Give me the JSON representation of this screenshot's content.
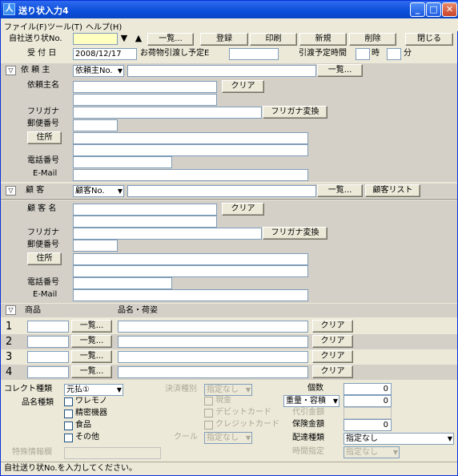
{
  "window": {
    "title": "送り状入力4",
    "minimize": "_",
    "maximize": "□",
    "close": "✕"
  },
  "menu": [
    "ファイル(F)",
    "ツール(T)",
    "ヘルプ(H)"
  ],
  "toolbar": {
    "slip_label": "自社送り状No.",
    "slip_value": "",
    "list": "一覧...",
    "register": "登録",
    "print": "印刷",
    "new": "新規",
    "delete": "削除",
    "close": "閉じる",
    "down_arrow": "▼",
    "up_arrow": "▲"
  },
  "row2": {
    "received_label": "受 付 日",
    "received_value": "2008/12/17",
    "handover_label": "お荷物引渡し予定E",
    "handover_value": "",
    "time_label": "引渡予定時間",
    "hour": "時",
    "minute": "分"
  },
  "client": {
    "header": "依 頼 主",
    "select": "依頼主No.",
    "list": "一覧...",
    "name_label": "依頼主名",
    "clear": "クリア",
    "kana_label": "フリガナ",
    "kana_convert": "フリガナ変換",
    "zip_label": "郵便番号",
    "address_button": "住所",
    "phone_label": "電話番号",
    "email_label": "E-Mail"
  },
  "customer": {
    "header": "顧   客",
    "select": "顧客No.",
    "list": "一覧...",
    "customer_list": "顧客リスト",
    "name_label": "顧 客 名",
    "clear": "クリア",
    "kana_label": "フリガナ",
    "kana_convert": "フリガナ変換",
    "zip_label": "郵便番号",
    "address_button": "住所",
    "phone_label": "電話番号",
    "email_label": "E-Mail"
  },
  "items": {
    "goods_label": "商品",
    "style_label": "品名・荷姿",
    "rows": [
      {
        "num": "1",
        "list": "一覧...",
        "clear": "クリア"
      },
      {
        "num": "2",
        "list": "一覧...",
        "clear": "クリア"
      },
      {
        "num": "3",
        "list": "一覧...",
        "clear": "クリア"
      },
      {
        "num": "4",
        "list": "一覧...",
        "clear": "クリア"
      }
    ]
  },
  "bottom": {
    "collect_label": "コレクト種類",
    "collect_value": "元払①",
    "goods_kind_label": "品名種類",
    "fragile": "ワレモノ",
    "precision": "精密機器",
    "food": "食品",
    "other": "その他",
    "special_label": "特殊情報欄",
    "payment_label": "決済種別",
    "payment_value": "指定なし",
    "cash": "現金",
    "debit": "デビットカード",
    "credit": "クレジットカード",
    "cool_label": "クール",
    "cool_value": "指定なし",
    "count_label": "個数",
    "count_value": "0",
    "weight_select": "重量・容積",
    "weight_value": "0",
    "cod_label": "代引金額",
    "insurance_label": "保険金額",
    "insurance_value": "0",
    "delivery_label": "配達種類",
    "delivery_value": "指定なし",
    "time_label": "時間指定",
    "time_value": "指定なし"
  },
  "status": "自社送り状No.を入力してください。"
}
